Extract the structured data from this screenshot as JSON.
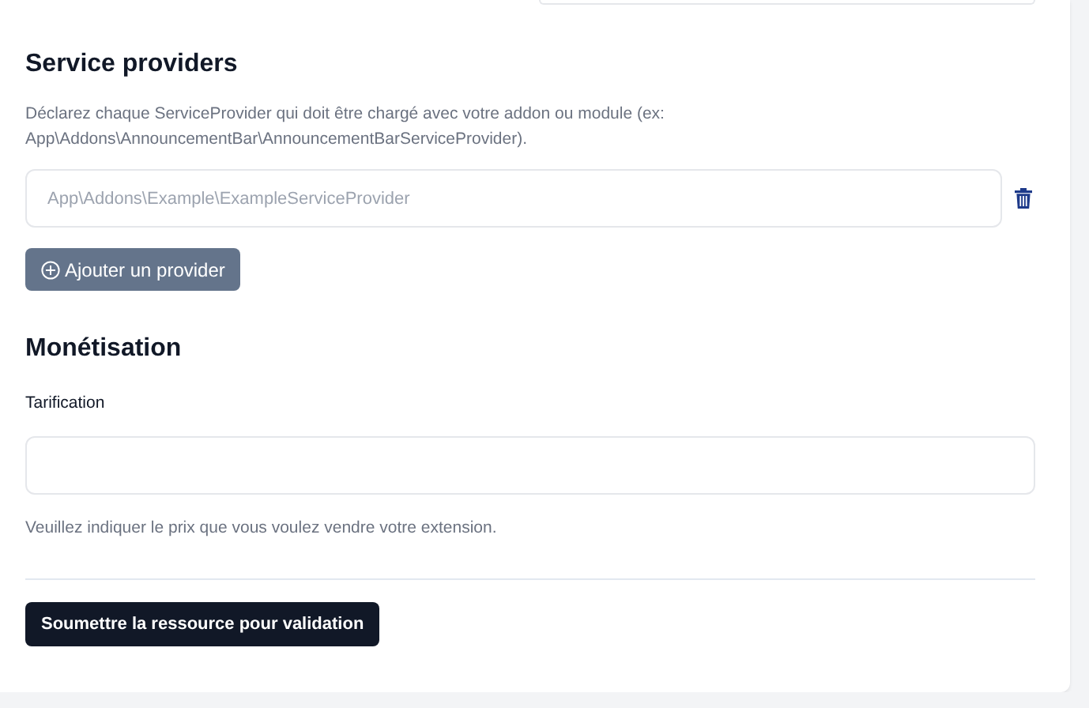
{
  "service_providers": {
    "title": "Service providers",
    "description": "Déclarez chaque ServiceProvider qui doit être chargé avec votre addon ou module (ex: App\\Addons\\AnnouncementBar\\AnnouncementBarServiceProvider).",
    "providers": [
      {
        "placeholder": "App\\Addons\\Example\\ExampleServiceProvider"
      }
    ],
    "add_button": "Ajouter un provider"
  },
  "monetisation": {
    "title": "Monétisation",
    "pricing_label": "Tarification",
    "pricing_help": "Veuillez indiquer le prix que vous voulez vendre votre extension."
  },
  "submit_button": "Soumettre la ressource pour validation"
}
